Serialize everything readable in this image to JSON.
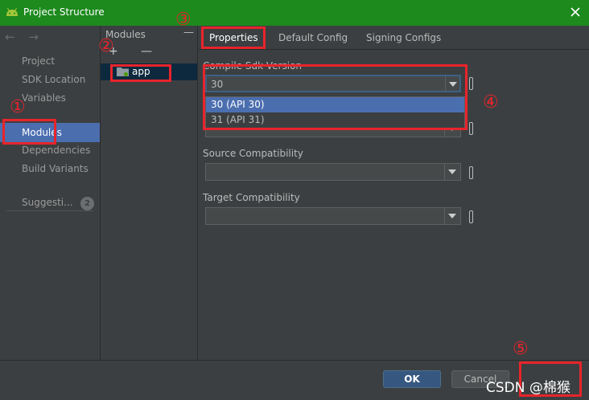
{
  "window": {
    "title": "Project Structure"
  },
  "nav": {
    "back_forward": "← →",
    "items": [
      "Project",
      "SDK Location",
      "Variables",
      "Modules",
      "Dependencies",
      "Build Variants"
    ],
    "suggestions_label": "Suggesti...",
    "suggestions_count": "2",
    "selected": "Modules"
  },
  "modules": {
    "title": "Modules",
    "collapse": "—",
    "tools": "+ —",
    "items": [
      "app"
    ]
  },
  "tabs": [
    "Properties",
    "Default Config",
    "Signing Configs"
  ],
  "properties": {
    "compile_sdk": {
      "label": "Compile Sdk Version",
      "value": "30"
    },
    "dropdown_options": [
      "30 (API 30)",
      "31 (API 31)"
    ],
    "source_compat": {
      "label": "Source Compatibility",
      "value": ""
    },
    "target_compat": {
      "label": "Target Compatibility",
      "value": ""
    }
  },
  "footer": {
    "ok": "OK",
    "cancel": "Cancel"
  },
  "annotations": [
    "①",
    "②",
    "③",
    "④",
    "⑤"
  ],
  "watermark": "CSDN @棉猴",
  "colors": {
    "titlebar": "#1d8a1e",
    "selection": "#4b6eaf",
    "annotation": "#e8242b",
    "ok_button": "#365880"
  }
}
